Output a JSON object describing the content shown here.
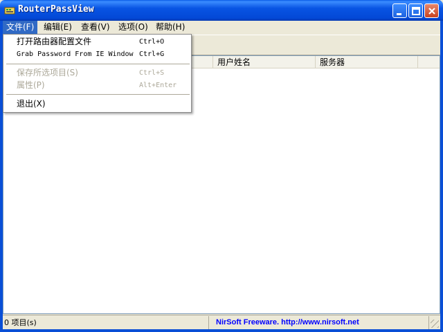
{
  "window": {
    "title": "RouterPassView",
    "icon": "key-app-icon",
    "controls": [
      "minimize-icon",
      "maximize-icon",
      "close-icon"
    ]
  },
  "menubar": {
    "items": [
      {
        "label": "文件(F)",
        "active": true
      },
      {
        "label": "编辑(E)"
      },
      {
        "label": "查看(V)"
      },
      {
        "label": "选项(O)"
      },
      {
        "label": "帮助(H)"
      }
    ]
  },
  "file_menu": {
    "items": [
      {
        "label": "打开路由器配置文件",
        "shortcut": "Ctrl+O",
        "enabled": true
      },
      {
        "label": "Grab Password From IE Window",
        "shortcut": "Ctrl+G",
        "enabled": true
      },
      {
        "label": "保存所选项目(S)",
        "shortcut": "Ctrl+S",
        "enabled": false
      },
      {
        "label": "属性(P)",
        "shortcut": "Alt+Enter",
        "enabled": false
      },
      {
        "label": "退出(X)",
        "shortcut": "",
        "enabled": true
      }
    ]
  },
  "list": {
    "columns": [
      "用户姓名",
      "服务器"
    ]
  },
  "statusbar": {
    "count": "0 项目(s)",
    "link": "NirSoft Freeware.  http://www.nirsoft.net"
  },
  "colors": {
    "titlebar": "#0a5de8",
    "menu_highlight": "#316ac5",
    "link": "#0000ff"
  }
}
